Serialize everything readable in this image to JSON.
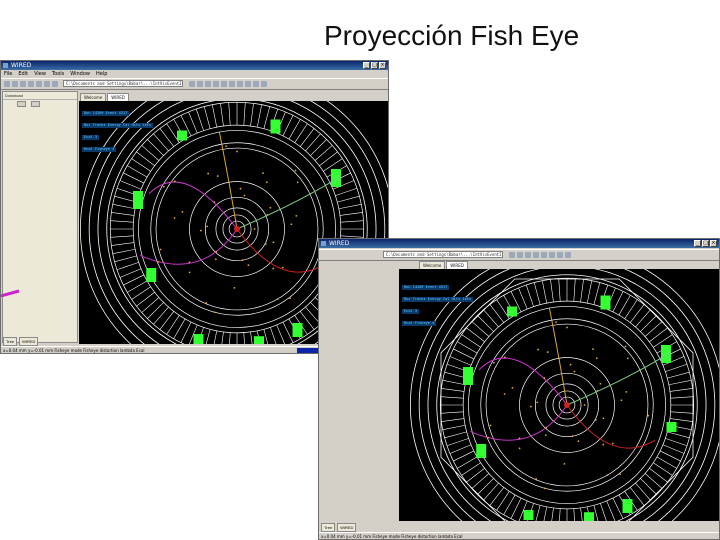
{
  "slide": {
    "title": "Proyección Fish Eye"
  },
  "colors": {
    "detector_lines": "#ffffff",
    "muon_hits": "#33ff33",
    "info_label_bg": "#0a3a6a",
    "info_label_text": "#66ccff",
    "track_magenta": "#cc33cc",
    "track_green": "#77cc88",
    "track_red": "#cc2222",
    "hits_yellow": "#ddaa33",
    "cursor": "#cc22cc",
    "titlebar": "#0a246a"
  },
  "window1": {
    "title": "WIRED",
    "menu": [
      "File",
      "Edit",
      "View",
      "Tools",
      "Window",
      "Help"
    ],
    "address": "C:\\Documents and Settings\\Babar\\...\\IntVisEventInterface\\Examples\\alephVisual.ev",
    "tabs": [
      "Welcome",
      "WIRED"
    ],
    "left_panel_label": "Download",
    "bottom_tabs": [
      "Tree",
      "WIRED"
    ],
    "status": "x=0.04 mm  y=-0.01 mm  Fisheye   mode  Fisheye distortion  lambda  Ecal",
    "progress_fraction": 0.8,
    "info_labels": [
      "Run 14209  Event 4317",
      "Bsc  Tracks  Energy  Cal  Hits  Jets",
      "Ecal  3",
      "Hcal  Fisheye  4"
    ],
    "icons": [
      "new-icon",
      "open-icon",
      "save-icon",
      "print-icon",
      "cut-icon",
      "copy-icon",
      "paste-icon",
      "undo-icon",
      "redo-icon",
      "zoom-in-icon",
      "zoom-out-icon",
      "rotate-icon",
      "pan-icon",
      "select-icon",
      "fisheye-icon",
      "projection-icon",
      "help-icon"
    ]
  },
  "window2": {
    "title": "WIRED",
    "address": "C:\\Documents and Settings\\Babar\\...\\IntVisEventInterface\\Examples\\alephVisual.ev",
    "tabs": [
      "Welcome",
      "WIRED"
    ],
    "bottom_tabs": [
      "Tree",
      "WIRED"
    ],
    "status": "x=0.04 mm  y=-0.01 mm  Fisheye   mode  Fisheye distortion  lambda  Ecal",
    "info_labels": [
      "Run 14209  Event 4317",
      "Bsc  Tracks  Energy  Cal  Hits  Jets",
      "Ecal  3",
      "Hcal  Fisheye  4"
    ],
    "icons": [
      "zoom-in-icon",
      "zoom-out-icon",
      "rotate-icon",
      "pan-icon",
      "select-icon",
      "fisheye-icon",
      "projection-icon",
      "help-icon"
    ]
  }
}
